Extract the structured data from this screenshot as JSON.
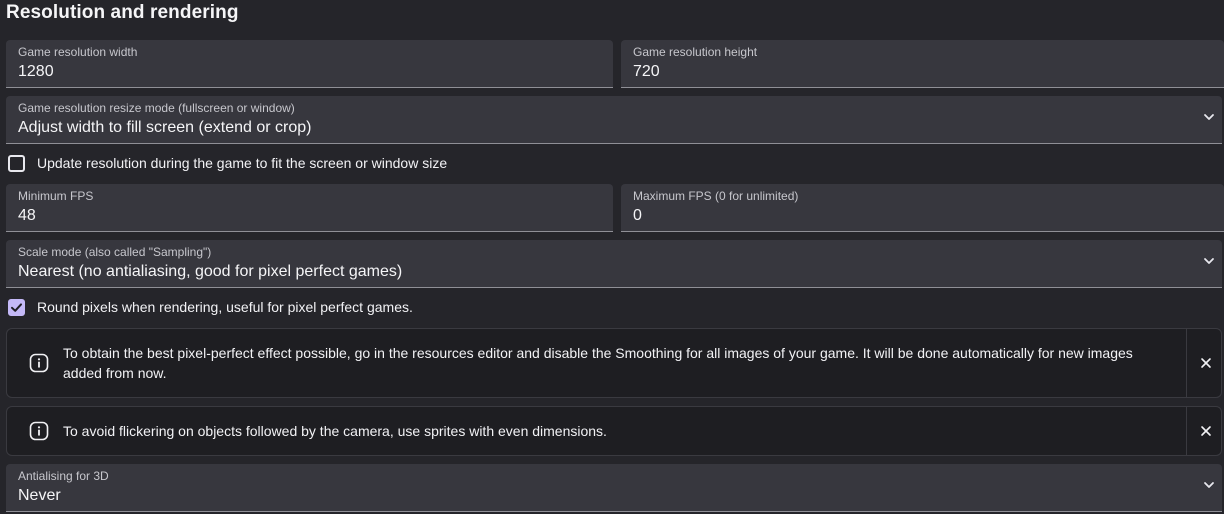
{
  "section": {
    "title": "Resolution and rendering"
  },
  "resolution_width": {
    "label": "Game resolution width",
    "value": "1280"
  },
  "resolution_height": {
    "label": "Game resolution height",
    "value": "720"
  },
  "resize_mode": {
    "label": "Game resolution resize mode (fullscreen or window)",
    "value": "Adjust width to fill screen (extend or crop)",
    "icon": "chevron-down-icon"
  },
  "update_resolution": {
    "label": "Update resolution during the game to fit the screen or window size",
    "checked": false
  },
  "min_fps": {
    "label": "Minimum FPS",
    "value": "48"
  },
  "max_fps": {
    "label": "Maximum FPS (0 for unlimited)",
    "value": "0"
  },
  "scale_mode": {
    "label": "Scale mode (also called \"Sampling\")",
    "value": "Nearest (no antialiasing, good for pixel perfect games)",
    "icon": "chevron-down-icon"
  },
  "round_pixels": {
    "label": "Round pixels when rendering, useful for pixel perfect games.",
    "checked": true
  },
  "alerts": [
    {
      "icon": "info-icon",
      "message": "To obtain the best pixel-perfect effect possible, go in the resources editor and disable the Smoothing for all images of your game. It will be done automatically for new images added from now.",
      "close_icon": "close-icon"
    },
    {
      "icon": "info-icon",
      "message": "To avoid flickering on objects followed by the camera, use sprites with even dimensions.",
      "close_icon": "close-icon"
    }
  ],
  "antialiasing_3d": {
    "label": "Antialising for 3D",
    "value": "Never",
    "icon": "chevron-down-icon"
  },
  "colors": {
    "background": "#25252a",
    "field_background": "#37373e",
    "alert_background": "#1e1e22",
    "checkbox_accent": "#c4b9f7"
  }
}
